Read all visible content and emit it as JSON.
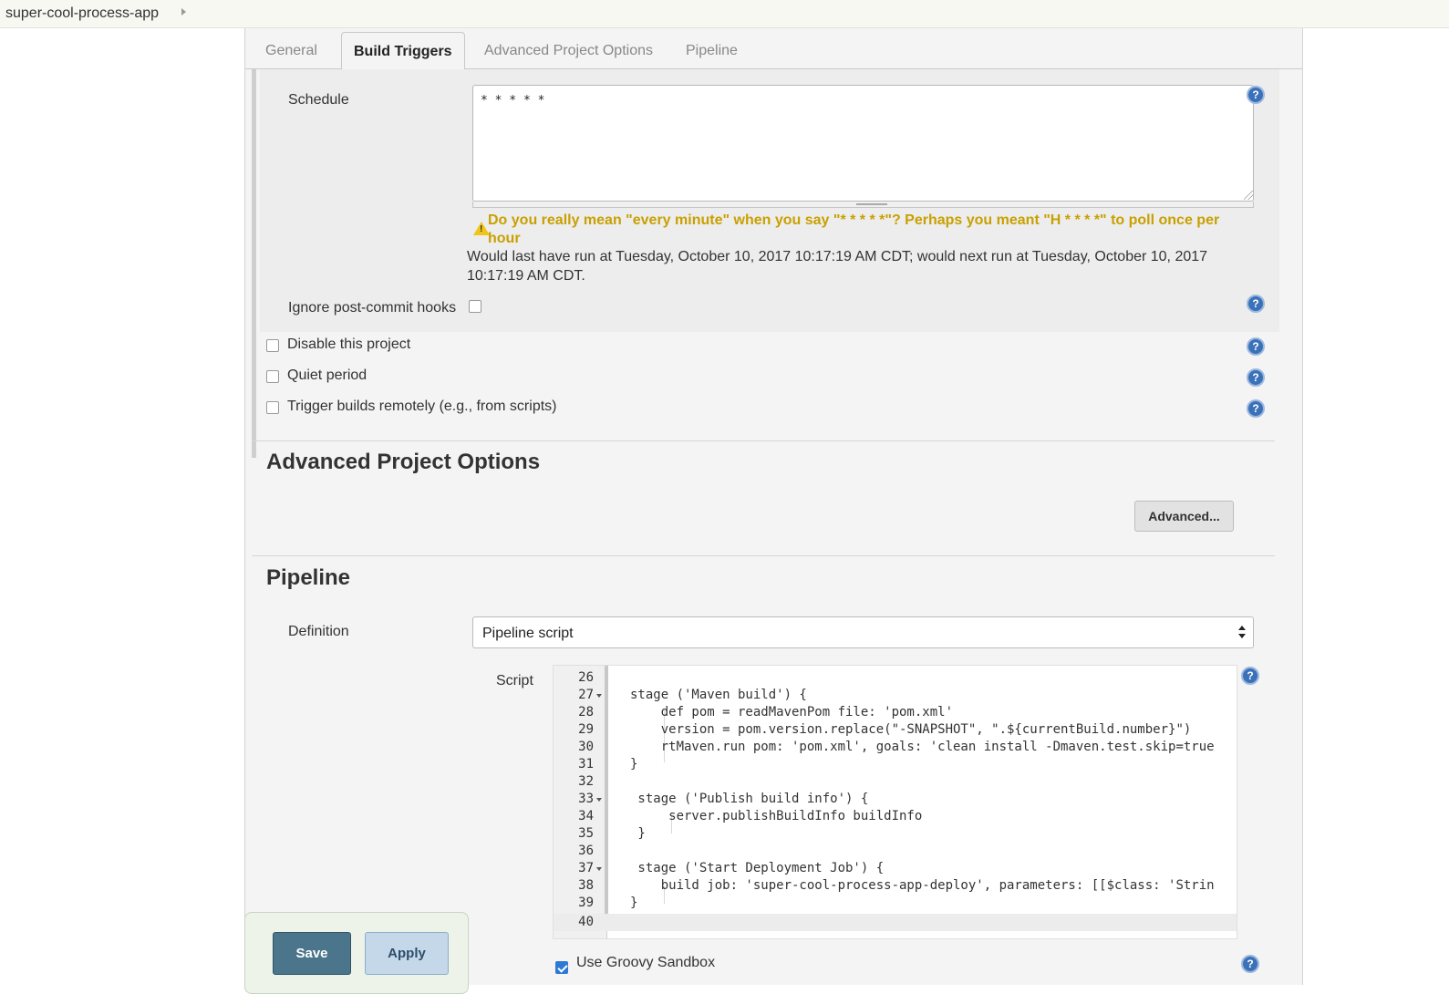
{
  "breadcrumb": {
    "project": "super-cool-process-app"
  },
  "tabs": [
    {
      "label": "General"
    },
    {
      "label": "Build Triggers"
    },
    {
      "label": "Advanced Project Options"
    },
    {
      "label": "Pipeline"
    }
  ],
  "schedule": {
    "label": "Schedule",
    "value": "* * * * *",
    "warning": "Do you really mean \"every minute\" when you say \"* * * * *\"? Perhaps you meant \"H * * * *\" to poll once per hour",
    "info": "Would last have run at Tuesday, October 10, 2017 10:17:19 AM CDT; would next run at Tuesday, October 10, 2017 10:17:19 AM CDT."
  },
  "ignore_hooks": {
    "label": "Ignore post-commit hooks",
    "checked": false
  },
  "options": [
    {
      "label": "Disable this project",
      "checked": false
    },
    {
      "label": "Quiet period",
      "checked": false
    },
    {
      "label": "Trigger builds remotely (e.g., from scripts)",
      "checked": false
    }
  ],
  "advanced_section": {
    "title": "Advanced Project Options",
    "button": "Advanced..."
  },
  "pipeline": {
    "title": "Pipeline",
    "definition_label": "Definition",
    "definition_value": "Pipeline script",
    "script_label": "Script",
    "code": [
      {
        "n": "26",
        "text": ""
      },
      {
        "n": "27",
        "text": "stage ('Maven build') {"
      },
      {
        "n": "28",
        "text": "    def pom = readMavenPom file: 'pom.xml'"
      },
      {
        "n": "29",
        "text": "    version = pom.version.replace(\"-SNAPSHOT\", \".${currentBuild.number}\")"
      },
      {
        "n": "30",
        "text": "    rtMaven.run pom: 'pom.xml', goals: 'clean install -Dmaven.test.skip=true"
      },
      {
        "n": "31",
        "text": "}"
      },
      {
        "n": "32",
        "text": ""
      },
      {
        "n": "33",
        "text": " stage ('Publish build info') {"
      },
      {
        "n": "34",
        "text": "     server.publishBuildInfo buildInfo"
      },
      {
        "n": "35",
        "text": " }"
      },
      {
        "n": "36",
        "text": ""
      },
      {
        "n": "37",
        "text": " stage ('Start Deployment Job') {"
      },
      {
        "n": "38",
        "text": "    build job: 'super-cool-process-app-deploy', parameters: [[$class: 'Strin"
      },
      {
        "n": "39",
        "text": "}"
      },
      {
        "n": "40",
        "text": ""
      }
    ],
    "sandbox_label": "Use Groovy Sandbox",
    "sandbox_checked": true
  },
  "actions": {
    "save": "Save",
    "apply": "Apply"
  },
  "icons": {
    "help": "help-icon",
    "warning": "warning-icon"
  },
  "colors": {
    "primary_button": "#4b758b",
    "secondary_button": "#c4d8ea",
    "warning_text": "#c9a000",
    "help": "#3b71b8"
  }
}
